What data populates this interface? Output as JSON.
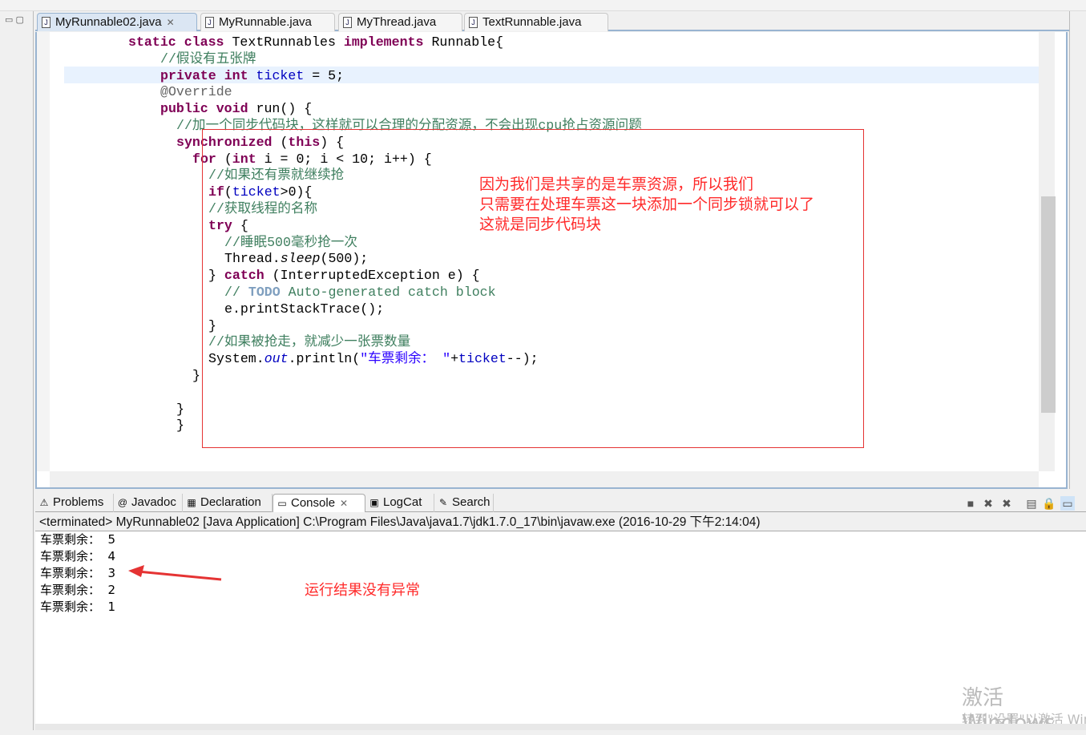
{
  "editor_tabs": [
    {
      "label": "MyRunnable02.java",
      "active": true,
      "closable": true
    },
    {
      "label": "MyRunnable.java"
    },
    {
      "label": "MyThread.java"
    },
    {
      "label": "TextRunnable.java"
    }
  ],
  "code_lines": [
    {
      "indent": 8,
      "tokens": [
        [
          "static",
          "kw"
        ],
        [
          " "
        ],
        [
          "class",
          "kw"
        ],
        [
          " TextRunnables "
        ],
        [
          "implements",
          "kw"
        ],
        [
          " Runnable{"
        ]
      ]
    },
    {
      "indent": 16,
      "tokens": [
        [
          "//假设有五张牌",
          "cm"
        ]
      ]
    },
    {
      "indent": 16,
      "tokens": [
        [
          "private",
          "kw"
        ],
        [
          " "
        ],
        [
          "int",
          "kw"
        ],
        [
          " "
        ],
        [
          "ticket",
          "fd"
        ],
        [
          " = 5;"
        ]
      ]
    },
    {
      "indent": 16,
      "tokens": [
        [
          "@Override",
          "an"
        ]
      ]
    },
    {
      "indent": 16,
      "tokens": [
        [
          "public",
          "kw"
        ],
        [
          " "
        ],
        [
          "void",
          "kw"
        ],
        [
          " run() {"
        ]
      ]
    },
    {
      "indent": 20,
      "tokens": [
        [
          "//加一个同步代码块，这样就可以合理的分配资源，不会出现cpu抢占资源问题",
          "cm"
        ]
      ]
    },
    {
      "indent": 20,
      "tokens": [
        [
          "synchronized",
          "kw"
        ],
        [
          " ("
        ],
        [
          "this",
          "kw"
        ],
        [
          ") {"
        ]
      ]
    },
    {
      "indent": 24,
      "tokens": [
        [
          "for",
          "kw"
        ],
        [
          " ("
        ],
        [
          "int",
          "kw"
        ],
        [
          " i = 0; i < 10; i++) {"
        ]
      ]
    },
    {
      "indent": 28,
      "tokens": [
        [
          "//如果还有票就继续抢",
          "cm"
        ]
      ]
    },
    {
      "indent": 28,
      "tokens": [
        [
          "if",
          "kw"
        ],
        [
          "("
        ],
        [
          "ticket",
          "fd"
        ],
        [
          ">0){"
        ]
      ]
    },
    {
      "indent": 28,
      "tokens": [
        [
          "//获取线程的名称",
          "cm"
        ]
      ]
    },
    {
      "indent": 28,
      "tokens": [
        [
          "try",
          "kw"
        ],
        [
          " {"
        ]
      ]
    },
    {
      "indent": 32,
      "tokens": [
        [
          "//睡眠500毫秒抢一次",
          "cm"
        ]
      ]
    },
    {
      "indent": 32,
      "tokens": [
        [
          "Thread."
        ],
        [
          "sleep",
          "it"
        ],
        [
          "(500);"
        ]
      ]
    },
    {
      "indent": 28,
      "tokens": [
        [
          "} "
        ],
        [
          "catch",
          "kw"
        ],
        [
          " (InterruptedException e) {"
        ]
      ]
    },
    {
      "indent": 32,
      "tokens": [
        [
          "// ",
          "cm"
        ],
        [
          "TODO",
          "todo"
        ],
        [
          " Auto-generated catch block",
          "cm"
        ]
      ]
    },
    {
      "indent": 32,
      "tokens": [
        [
          "e.printStackTrace();"
        ]
      ]
    },
    {
      "indent": 28,
      "tokens": [
        [
          "}"
        ]
      ]
    },
    {
      "indent": 28,
      "tokens": [
        [
          "//如果被抢走，就减少一张票数量",
          "cm"
        ]
      ]
    },
    {
      "indent": 28,
      "tokens": [
        [
          "System."
        ],
        [
          "out",
          "fd it"
        ],
        [
          ".println("
        ],
        [
          "\"车票剩余： \"",
          "st"
        ],
        [
          "+"
        ],
        [
          "ticket",
          "fd"
        ],
        [
          "--);"
        ]
      ]
    },
    {
      "indent": 24,
      "tokens": [
        [
          "}"
        ]
      ]
    },
    {
      "indent": 0,
      "tokens": []
    },
    {
      "indent": 20,
      "tokens": [
        [
          "}"
        ]
      ]
    },
    {
      "indent": 20,
      "tokens": [
        [
          "}"
        ]
      ]
    }
  ],
  "annotations": {
    "code_note": [
      "因为我们是共享的是车票资源，所以我们",
      "只需要在处理车票这一块添加一个同步锁就可以了",
      "这就是同步代码块"
    ],
    "console_note": "运行结果没有异常"
  },
  "console_tabs": [
    {
      "label": "Problems",
      "icon": "problems-icon"
    },
    {
      "label": "Javadoc",
      "icon": "at-icon"
    },
    {
      "label": "Declaration",
      "icon": "declaration-icon"
    },
    {
      "label": "Console",
      "icon": "console-icon",
      "active": true
    },
    {
      "label": "LogCat",
      "icon": "logcat-icon"
    },
    {
      "label": "Search",
      "icon": "search-icon"
    }
  ],
  "console": {
    "header": "<terminated> MyRunnable02 [Java Application] C:\\Program Files\\Java\\java1.7\\jdk1.7.0_17\\bin\\javaw.exe (2016-10-29 下午2:14:04)",
    "output": [
      "车票剩余：  5",
      "车票剩余：  4",
      "车票剩余：  3",
      "车票剩余：  2",
      "车票剩余：  1"
    ]
  },
  "watermark": {
    "line1": "激活 Windows",
    "line2": "转到\"设置\"以激活 Windows。"
  },
  "colors": {
    "annotation": "#ff2a2a",
    "keyword": "#7f0055",
    "comment": "#3f7f5f",
    "field": "#0000c0"
  }
}
